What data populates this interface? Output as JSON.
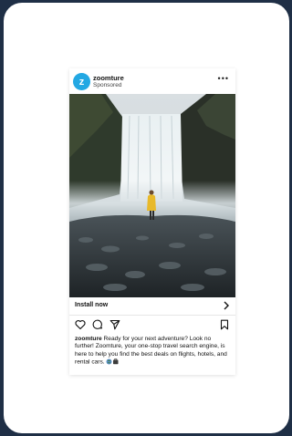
{
  "post": {
    "avatar_letter": "z",
    "brand_name": "zoomture",
    "sponsored_label": "Sponsored",
    "more_label": "•••",
    "cta_label": "Install now",
    "caption_user": "zoomture",
    "caption_text": "Ready for your next adventure? Look no further! Zoomture, your one-stop travel search engine, is here to help you find the best deals on flights, hotels, and rental cars.",
    "icons": [
      "heart-icon",
      "comment-icon",
      "share-icon",
      "bookmark-icon",
      "globe-emoji",
      "luggage-emoji"
    ]
  },
  "colors": {
    "page_background": "#1f2f46",
    "avatar": "#23a8e3",
    "jacket": "#e8b92a"
  }
}
